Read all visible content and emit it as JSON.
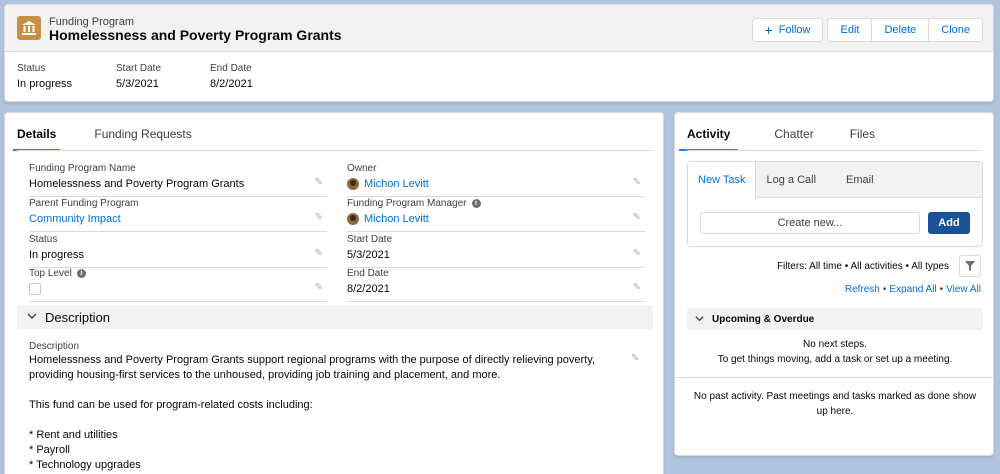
{
  "header": {
    "object_type": "Funding Program",
    "title": "Homelessness and Poverty Program Grants",
    "icon": "bank-icon",
    "buttons": {
      "follow": "Follow",
      "edit": "Edit",
      "delete": "Delete",
      "clone": "Clone"
    },
    "highlights": [
      {
        "label": "Status",
        "value": "In progress"
      },
      {
        "label": "Start Date",
        "value": "5/3/2021"
      },
      {
        "label": "End Date",
        "value": "8/2/2021"
      }
    ]
  },
  "details": {
    "tabs": [
      "Details",
      "Funding Requests"
    ],
    "fields": {
      "program_name": {
        "label": "Funding Program Name",
        "value": "Homelessness and Poverty Program Grants"
      },
      "owner": {
        "label": "Owner",
        "value": "Michon Levitt"
      },
      "parent_program": {
        "label": "Parent Funding Program",
        "value": "Community Impact"
      },
      "manager": {
        "label": "Funding Program Manager",
        "value": "Michon Levitt"
      },
      "status": {
        "label": "Status",
        "value": "In progress"
      },
      "start_date": {
        "label": "Start Date",
        "value": "5/3/2021"
      },
      "top_level": {
        "label": "Top Level",
        "checked": false
      },
      "end_date": {
        "label": "End Date",
        "value": "8/2/2021"
      }
    },
    "description_section": {
      "title": "Description",
      "label": "Description",
      "paragraph1": "Homelessness and Poverty Program Grants support regional programs with the purpose of directly relieving poverty, providing housing-first services to the unhoused, providing job training and placement, and more.",
      "paragraph2": "This fund can be used for program-related costs including:",
      "items": [
        "* Rent and utilities",
        "* Payroll",
        "* Technology upgrades"
      ]
    }
  },
  "activity": {
    "tabs": [
      "Activity",
      "Chatter",
      "Files"
    ],
    "composer_tabs": [
      "New Task",
      "Log a Call",
      "Email"
    ],
    "create_placeholder": "Create new...",
    "add_label": "Add",
    "filters_text": "Filters: All time • All activities • All types",
    "links": [
      "Refresh",
      "Expand All",
      "View All"
    ],
    "upcoming_title": "Upcoming & Overdue",
    "no_steps_1": "No next steps.",
    "no_steps_2": "To get things moving, add a task or set up a meeting.",
    "no_past": "No past activity. Past meetings and tasks marked as done show up here."
  },
  "colors": {
    "brand_blue": "#0070d2",
    "add_button": "#1b5297",
    "object_icon": "#c98f46",
    "background": "#b0c4df"
  }
}
